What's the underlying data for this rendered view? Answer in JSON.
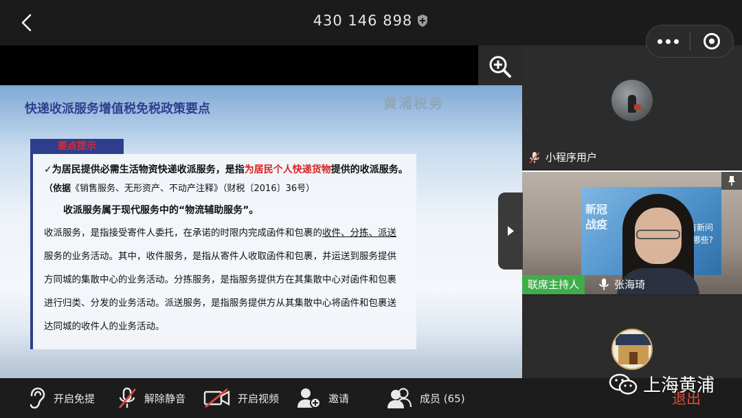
{
  "topbar": {
    "meeting_id": "430 146 898"
  },
  "stage": {
    "slide": {
      "title": "快递收派服务增值税免税政策要点",
      "logo_text": "黄浦税务",
      "tip_label": "要点提示",
      "line1_pre": "✓为居民提供必需生活物资快递收派服务，是指",
      "line1_red": "为居民个人快递货物",
      "line1_post": "提供的收派服务。",
      "line2_bold": "（依据",
      "line2_rest": "《销售服务、无形资产、不动产注释》（财税〔2016〕36号）",
      "line3": "收派服务属于现代服务中的“物流辅助服务”。",
      "body1_a": "收派服务，是指接受寄件人委托，在承诺的时限内完成函件和包裹的",
      "body1_u": "收件、分拣、派送",
      "body2": "服务的业务活动。其中，收件服务，是指从寄件人收取函件和包裹，并运送到服务提供",
      "body3": "方同城的集散中心的业务活动。分拣服务，是指服务提供方在其集散中心对函件和包裹",
      "body4": "进行归类、分发的业务活动。派送服务，是指服务提供方从其集散中心将函件和包裹送",
      "body5": "达同城的收件人的业务活动。"
    }
  },
  "participants": {
    "tile1_name": "小程序用户",
    "tile2_role": "联席主持人",
    "tile2_name": "张海琦",
    "poster_text": "新冠\n战疫",
    "poster_text2": "有新问\n策有哪些?"
  },
  "toolbar": {
    "handsfree_label": "开启免提",
    "unmute_label": "解除静音",
    "video_label": "开启视频",
    "invite_label": "邀请",
    "members_label": "成员 (65)",
    "exit_label": "退出"
  },
  "watermark": {
    "text": "上海黄浦"
  },
  "colors": {
    "host_tag": "#3fae49",
    "exit": "#e24a3a",
    "slide_title": "#2f3f8f",
    "highlight_red": "#d92020"
  }
}
